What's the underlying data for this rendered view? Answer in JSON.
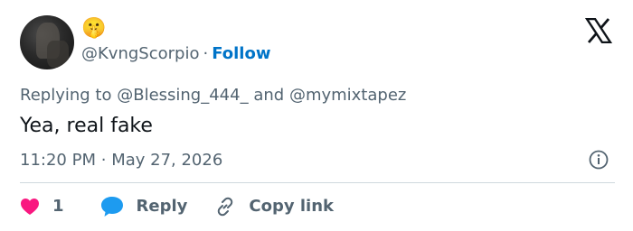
{
  "author": {
    "display_name": "🤫",
    "handle": "@KvngScorpio",
    "separator": "·",
    "follow_label": "Follow"
  },
  "reply_context": {
    "prefix": "Replying to",
    "mention1": "@Blessing_444_",
    "conjunction": "and",
    "mention2": "@mymixtapez"
  },
  "tweet": {
    "text": "Yea, real fake",
    "time": "11:20 PM",
    "separator": "·",
    "date": "May 27, 2026"
  },
  "actions": {
    "like_count": "1",
    "reply_label": "Reply",
    "copy_label": "Copy link"
  },
  "icons": {
    "logo": "x-logo-icon",
    "info": "info-icon",
    "like": "heart-icon",
    "reply": "speech-bubble-icon",
    "copy": "link-icon"
  },
  "colors": {
    "like": "#f91880",
    "reply": "#1d9bf0",
    "follow": "#0074c8",
    "secondary_text": "#536471",
    "primary_text": "#0f1419"
  }
}
